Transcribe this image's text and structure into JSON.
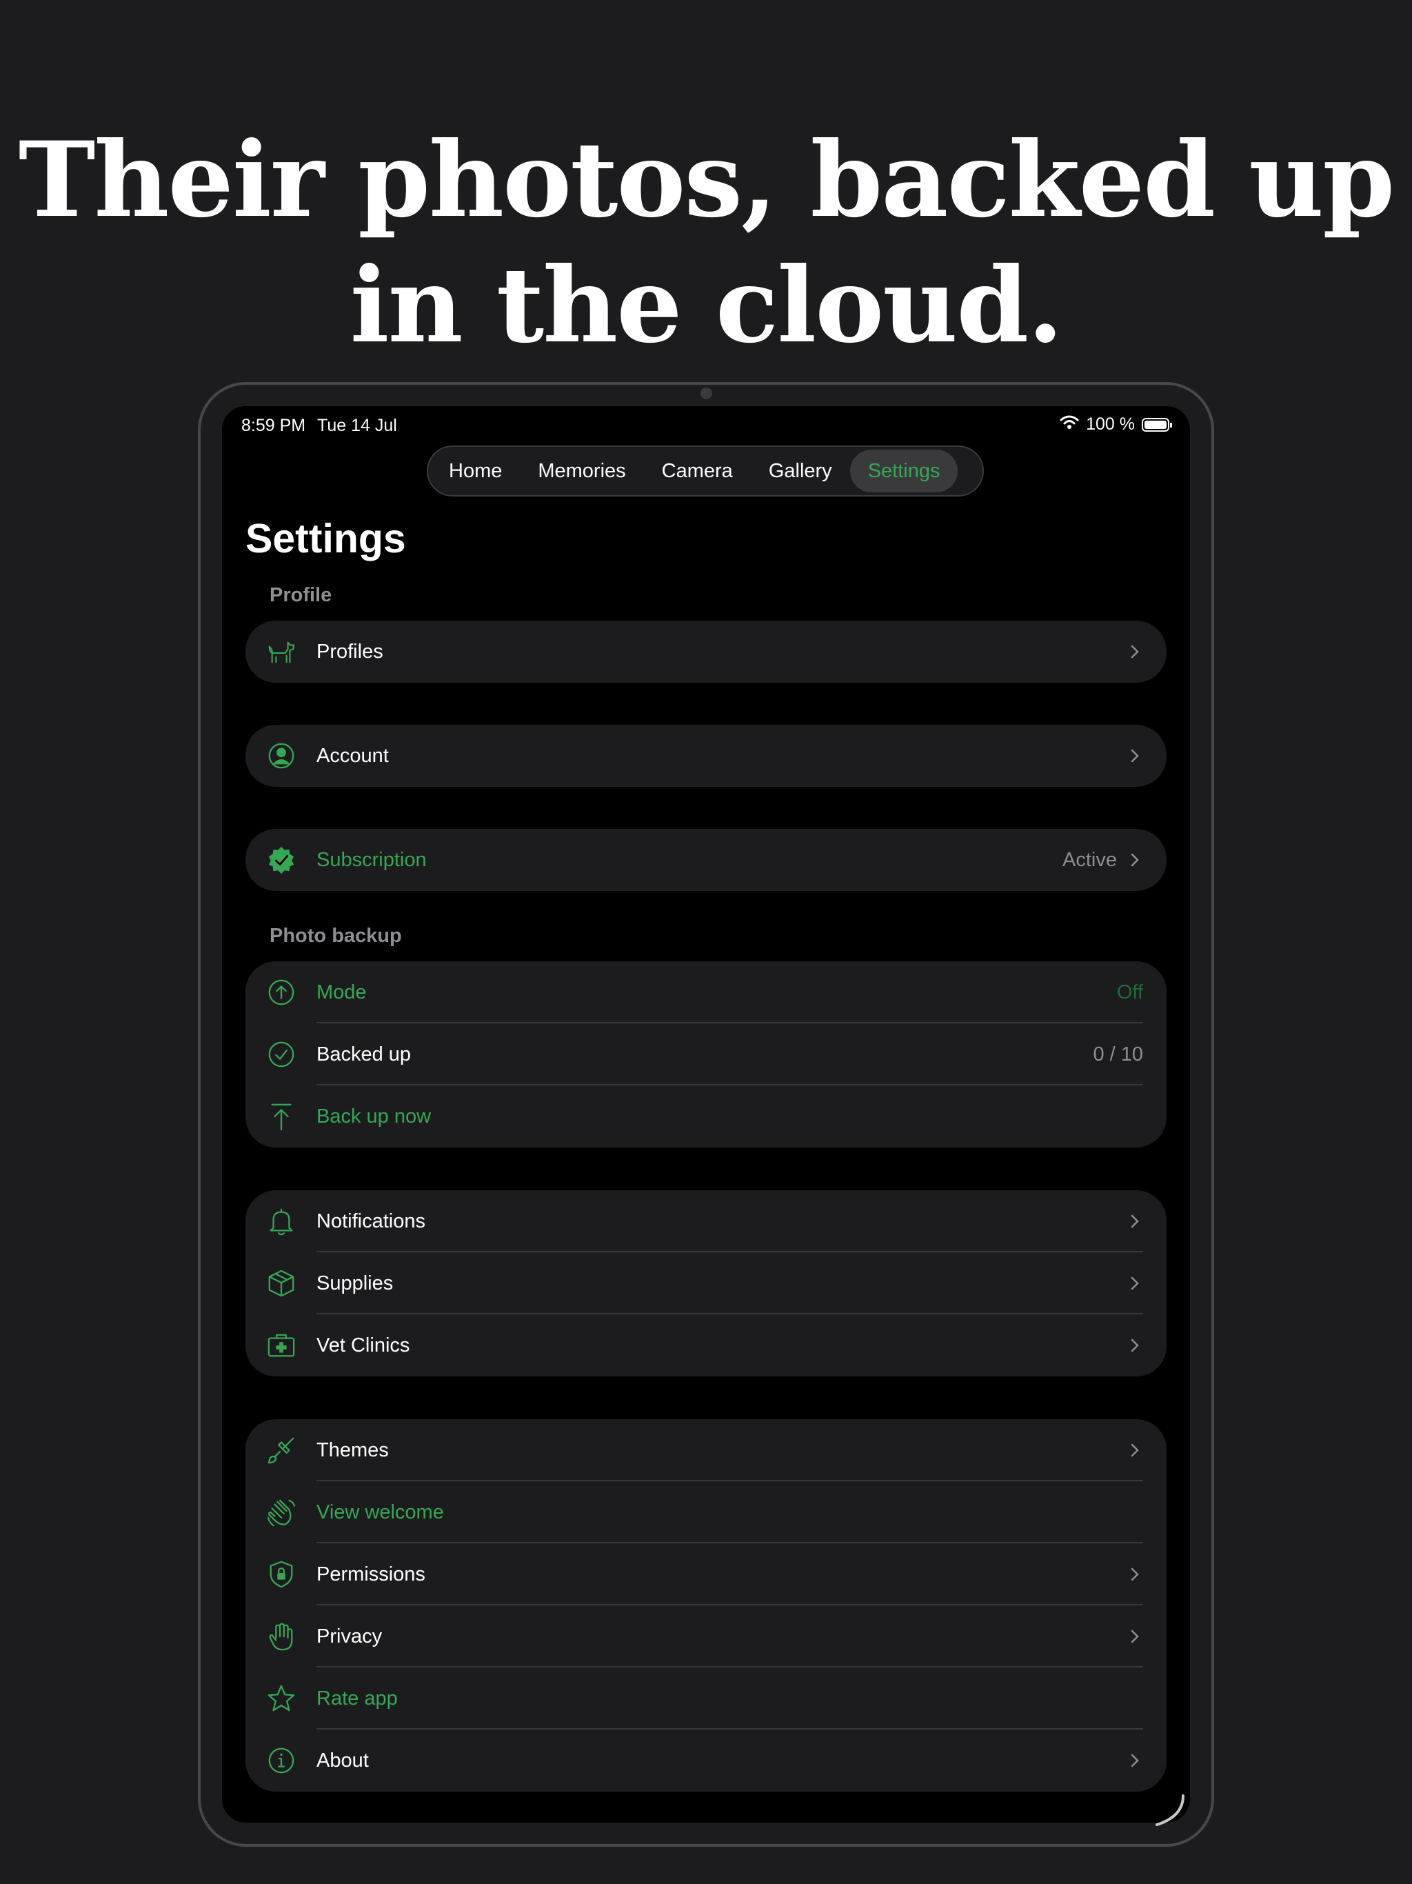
{
  "headline": {
    "line1": "Their photos, backed up",
    "line2": "in the cloud."
  },
  "status_bar": {
    "time": "8:59 PM",
    "date": "Tue 14 Jul",
    "battery": "100 %"
  },
  "tabs": [
    {
      "label": "Home"
    },
    {
      "label": "Memories"
    },
    {
      "label": "Camera"
    },
    {
      "label": "Gallery"
    },
    {
      "label": "Settings"
    }
  ],
  "active_tab": "Settings",
  "page_title": "Settings",
  "sections": {
    "profile": "Profile",
    "photo_backup": "Photo backup"
  },
  "profile_group": {
    "profiles": "Profiles"
  },
  "account_group": {
    "account": "Account"
  },
  "subscription_group": {
    "label": "Subscription",
    "value": "Active"
  },
  "backup_group": {
    "mode": {
      "label": "Mode",
      "value": "Off"
    },
    "backed_up": {
      "label": "Backed up",
      "value": "0 / 10"
    },
    "back_up_now": {
      "label": "Back up now"
    }
  },
  "general_group": {
    "notifications": "Notifications",
    "supplies": "Supplies",
    "vet_clinics": "Vet Clinics"
  },
  "app_group": {
    "themes": "Themes",
    "view_welcome": "View welcome",
    "permissions": "Permissions",
    "privacy": "Privacy",
    "rate_app": "Rate app",
    "about": "About"
  },
  "colors": {
    "accent": "#34a853",
    "background": "#000000",
    "card": "#1c1c1e",
    "secondary_text": "#8e8e93"
  },
  "icons": {
    "profiles": "dog-icon",
    "account": "person-circle-icon",
    "subscription": "checkmark-seal-icon",
    "mode": "arrow-up-circle-icon",
    "backed_up": "checkmark-circle-icon",
    "back_up_now": "arrow-up-to-line-icon",
    "notifications": "bell-icon",
    "supplies": "box-icon",
    "vet_clinics": "medical-kit-icon",
    "themes": "paintbrush-icon",
    "view_welcome": "waving-hand-icon",
    "permissions": "lock-shield-icon",
    "privacy": "raised-hand-icon",
    "rate_app": "star-icon",
    "about": "info-circle-icon"
  }
}
